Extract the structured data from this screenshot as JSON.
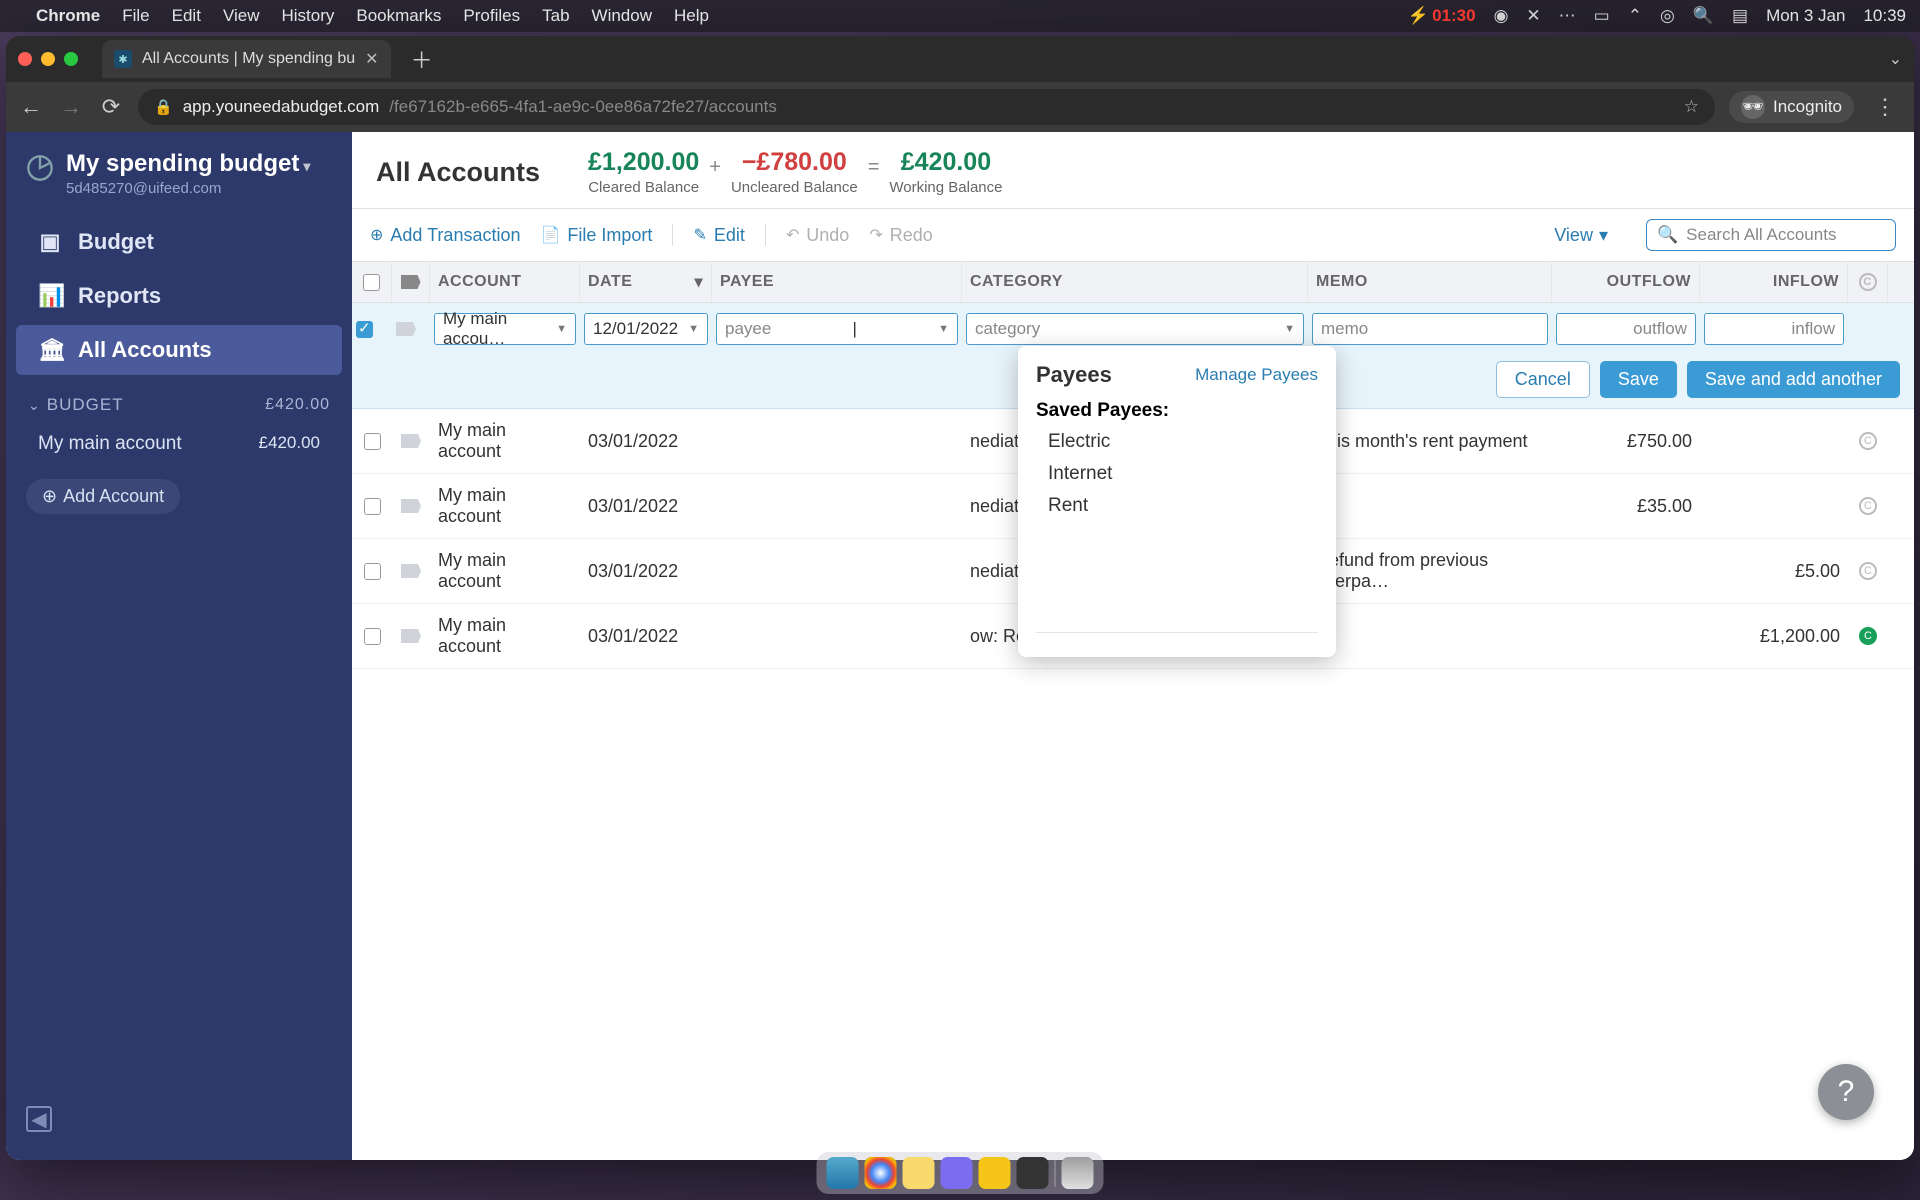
{
  "menubar": {
    "app": "Chrome",
    "items": [
      "File",
      "Edit",
      "View",
      "History",
      "Bookmarks",
      "Profiles",
      "Tab",
      "Window",
      "Help"
    ],
    "battery": "01:30",
    "date": "Mon 3 Jan",
    "time": "10:39"
  },
  "tab": {
    "title": "All Accounts | My spending bu"
  },
  "url": {
    "host": "app.youneedabudget.com",
    "path": "/fe67162b-e665-4fa1-ae9c-0ee86a72fe27/accounts"
  },
  "incognito": "Incognito",
  "sidebar": {
    "title": "My spending budget",
    "email": "5d485270@uifeed.com",
    "nav": {
      "budget": "Budget",
      "reports": "Reports",
      "all_accounts": "All Accounts"
    },
    "section": {
      "label": "BUDGET",
      "amount": "£420.00"
    },
    "account": {
      "name": "My main account",
      "amount": "£420.00"
    },
    "add_account": "Add Account"
  },
  "header": {
    "title": "All Accounts",
    "cleared": {
      "amount": "£1,200.00",
      "label": "Cleared Balance"
    },
    "uncleared": {
      "amount": "−£780.00",
      "label": "Uncleared Balance"
    },
    "working": {
      "amount": "£420.00",
      "label": "Working Balance"
    }
  },
  "toolbar": {
    "add": "Add Transaction",
    "import": "File Import",
    "edit": "Edit",
    "undo": "Undo",
    "redo": "Redo",
    "view": "View",
    "search_placeholder": "Search All Accounts"
  },
  "columns": {
    "account": "ACCOUNT",
    "date": "DATE",
    "payee": "PAYEE",
    "category": "CATEGORY",
    "memo": "MEMO",
    "outflow": "OUTFLOW",
    "inflow": "INFLOW"
  },
  "edit_row": {
    "account": "My main accou…",
    "date": "12/01/2022",
    "payee_placeholder": "payee",
    "category_placeholder": "category",
    "memo_placeholder": "memo",
    "outflow_placeholder": "outflow",
    "inflow_placeholder": "inflow",
    "cancel": "Cancel",
    "save": "Save",
    "save_add": "Save and add another"
  },
  "payee_popup": {
    "title": "Payees",
    "manage": "Manage Payees",
    "saved_label": "Saved Payees:",
    "items": [
      "Electric",
      "Internet",
      "Rent"
    ]
  },
  "rows": [
    {
      "account": "My main account",
      "date": "03/01/2022",
      "category": "nediate Obligations: Rent/Mortgage",
      "memo": "This month's rent payment",
      "outflow": "£750.00",
      "inflow": "",
      "cleared": false
    },
    {
      "account": "My main account",
      "date": "03/01/2022",
      "category": "nediate Obligations: Electric",
      "memo": "",
      "outflow": "£35.00",
      "inflow": "",
      "cleared": false
    },
    {
      "account": "My main account",
      "date": "03/01/2022",
      "category": "nediate Obligations: Internet",
      "memo": "Refund from previous overpa…",
      "outflow": "",
      "inflow": "£5.00",
      "cleared": false
    },
    {
      "account": "My main account",
      "date": "03/01/2022",
      "category": "ow: Ready to Assign",
      "memo": "",
      "outflow": "",
      "inflow": "£1,200.00",
      "cleared": true
    }
  ]
}
